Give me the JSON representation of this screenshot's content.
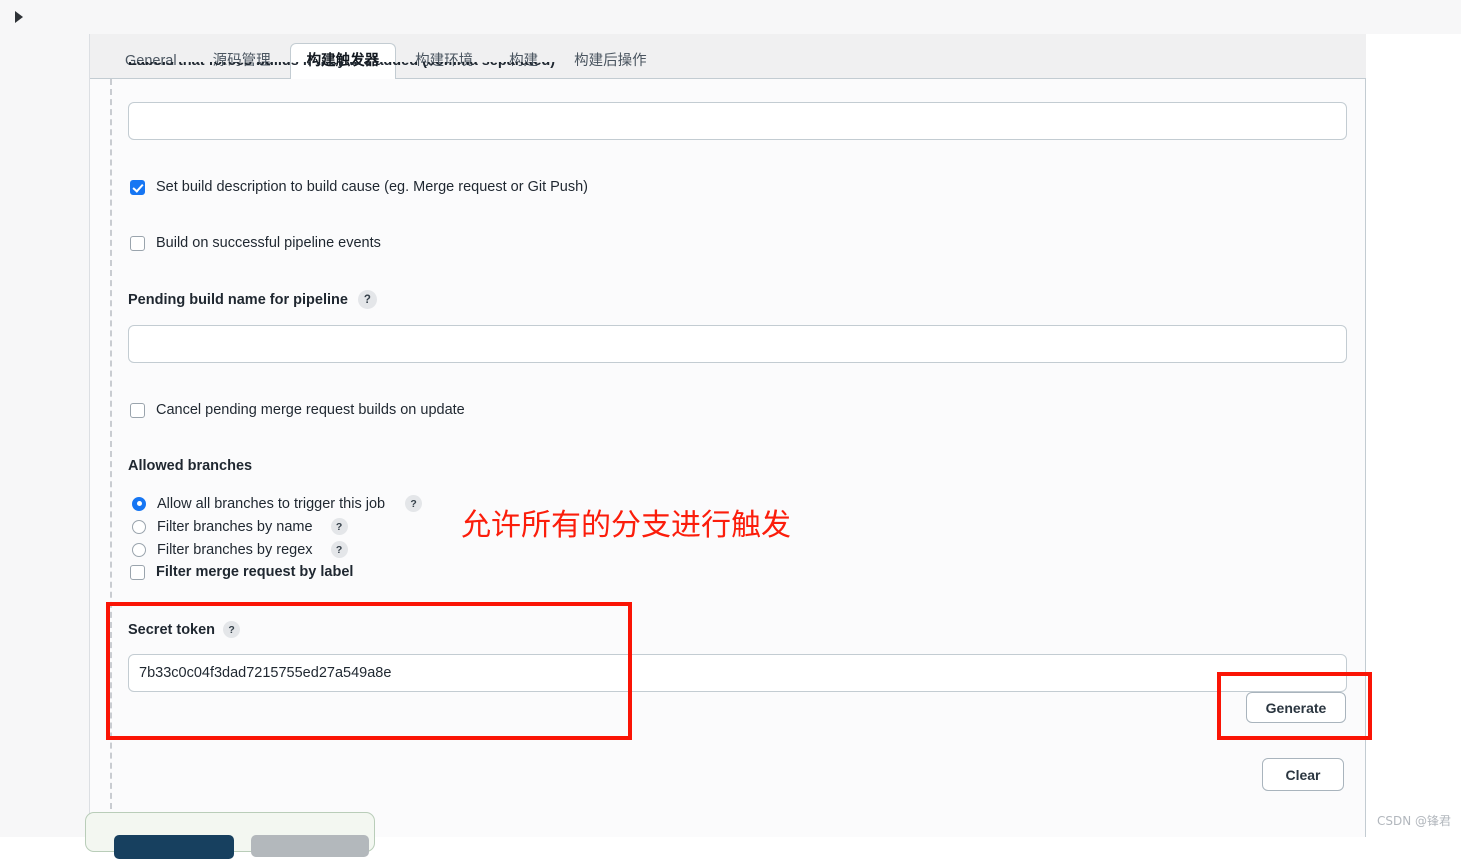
{
  "window": {
    "panel_toggle_icon": "triangle-right-icon"
  },
  "tabs": [
    {
      "label": "General",
      "active": false
    },
    {
      "label": "源码管理",
      "active": false
    },
    {
      "label": "构建触发器",
      "active": true
    },
    {
      "label": "构建环境",
      "active": false
    },
    {
      "label": "构建",
      "active": false
    },
    {
      "label": "构建后操作",
      "active": false
    }
  ],
  "form": {
    "labels_force_build": {
      "label": "Labels that forces builds if they are added (comma separated)",
      "value": "",
      "placeholder": ""
    },
    "set_build_description": {
      "label": "Set build description to build cause (eg. Merge request or Git Push)",
      "checked": true
    },
    "build_on_successful_pipeline": {
      "label": "Build on successful pipeline events",
      "checked": false
    },
    "pending_build_name": {
      "label": "Pending build name for pipeline",
      "help": "?",
      "value": "",
      "placeholder": ""
    },
    "cancel_pending_builds": {
      "label": "Cancel pending merge request builds on update",
      "checked": false
    },
    "allowed_branches": {
      "heading": "Allowed branches",
      "options": [
        {
          "label": "Allow all branches to trigger this job",
          "help": "?",
          "selected": true
        },
        {
          "label": "Filter branches by name",
          "help": "?",
          "selected": false
        },
        {
          "label": "Filter branches by regex",
          "help": "?",
          "selected": false
        }
      ],
      "filter_merge_request_by_label": {
        "label": "Filter merge request by label",
        "checked": false
      }
    },
    "secret_token": {
      "label": "Secret token",
      "help": "?",
      "value": "7b33c0c04f3dad7215755ed27a549a8e",
      "placeholder": ""
    }
  },
  "buttons": {
    "generate": "Generate",
    "clear": "Clear"
  },
  "annotations": {
    "allowed_branches_note": "允许所有的分支进行触发",
    "color": "#fb1d0b"
  },
  "watermark": "CSDN @锋君"
}
